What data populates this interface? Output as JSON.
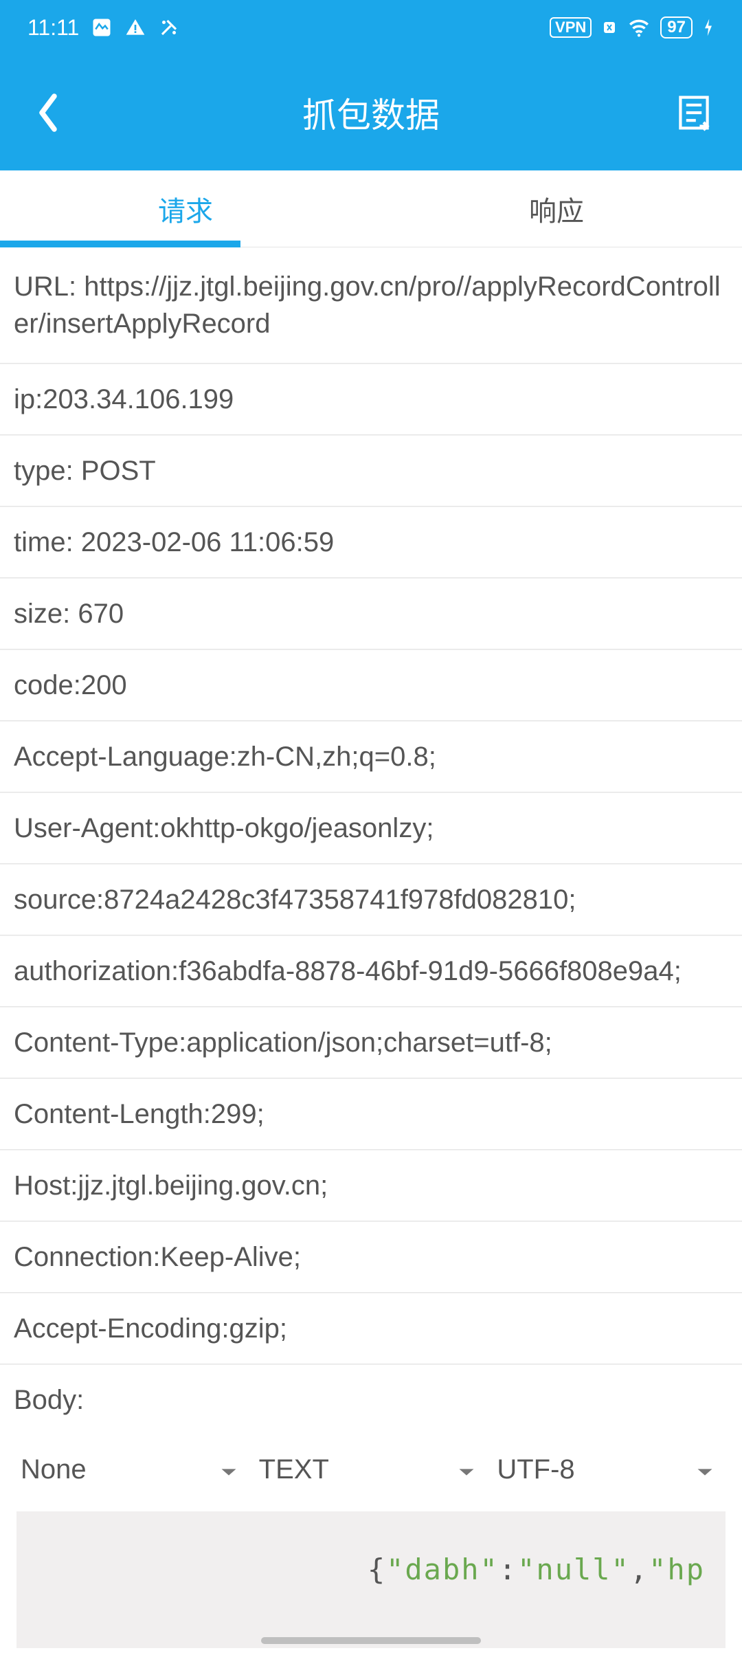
{
  "status": {
    "time": "11:11",
    "vpn": "VPN",
    "battery": "97"
  },
  "header": {
    "title": "抓包数据"
  },
  "tabs": {
    "request": "请求",
    "response": "响应"
  },
  "rows": {
    "url": "URL: https://jjz.jtgl.beijing.gov.cn/pro//applyRecordController/insertApplyRecord",
    "ip": "ip:203.34.106.199",
    "type": "type: POST",
    "time": "time: 2023-02-06 11:06:59",
    "size": "size: 670",
    "code": "code:200",
    "accept_language": "Accept-Language:zh-CN,zh;q=0.8;",
    "user_agent": "User-Agent:okhttp-okgo/jeasonlzy;",
    "source": "source:8724a2428c3f47358741f978fd082810;",
    "authorization": "authorization:f36abdfa-8878-46bf-91d9-5666f808e9a4;",
    "content_type": "Content-Type:application/json;charset=utf-8;",
    "content_length": "Content-Length:299;",
    "host": "Host:jjz.jtgl.beijing.gov.cn;",
    "connection": "Connection:Keep-Alive;",
    "accept_encoding": "Accept-Encoding:gzip;",
    "body_label": "Body:"
  },
  "dropdowns": {
    "d1": "None",
    "d2": "TEXT",
    "d3": "UTF-8"
  },
  "body": {
    "brace_open": "{",
    "k1": "\"dabh\"",
    "colon": ":",
    "v1": "\"null\"",
    "comma": ",",
    "k2": "\"hp"
  }
}
